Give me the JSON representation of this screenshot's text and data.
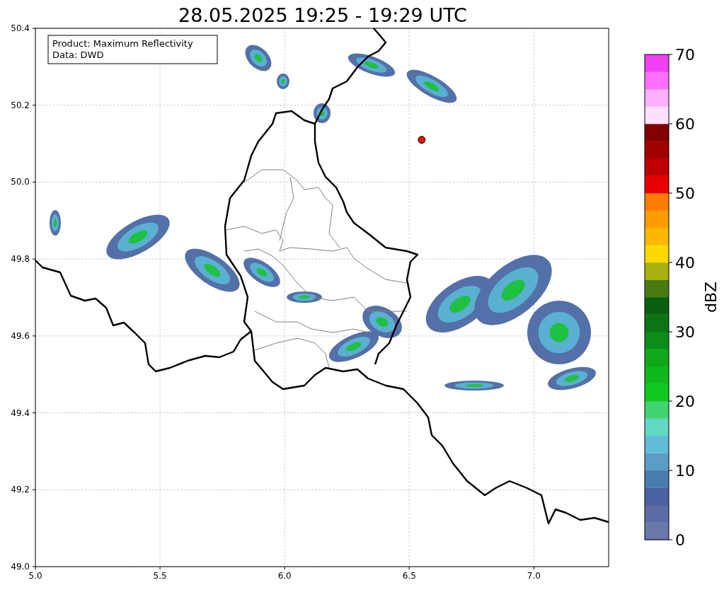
{
  "title": "28.05.2025 19:25 - 19:29 UTC",
  "map": {
    "info_box": [
      "Product: Maximum Reflectivity",
      "Data: DWD"
    ],
    "xticks": [
      "5.0",
      "5.5",
      "6.0",
      "6.5",
      "7.0"
    ],
    "yticks": [
      "50.4",
      "50.2",
      "50.0",
      "49.8",
      "49.6",
      "49.4",
      "49.2",
      "49.0"
    ]
  },
  "colorbar": {
    "label": "dBZ",
    "ticks": [
      "70",
      "60",
      "50",
      "40",
      "30",
      "20",
      "10",
      "0"
    ],
    "bands": [
      {
        "color": "#6878a8"
      },
      {
        "color": "#5a6ca4"
      },
      {
        "color": "#4a62a0"
      },
      {
        "color": "#4a7cb0"
      },
      {
        "color": "#5a9ec8"
      },
      {
        "color": "#60bcd8"
      },
      {
        "color": "#60d8c4"
      },
      {
        "color": "#40d470"
      },
      {
        "color": "#10c820"
      },
      {
        "color": "#10b81c"
      },
      {
        "color": "#10a818"
      },
      {
        "color": "#0c8c18"
      },
      {
        "color": "#0c7414"
      },
      {
        "color": "#0a6010"
      },
      {
        "color": "#4a7a10"
      },
      {
        "color": "#a8b010"
      },
      {
        "color": "#ffd800"
      },
      {
        "color": "#ffb800"
      },
      {
        "color": "#ff9c00"
      },
      {
        "color": "#ff7c00"
      },
      {
        "color": "#e80000"
      },
      {
        "color": "#c00000"
      },
      {
        "color": "#a00000"
      },
      {
        "color": "#800000"
      },
      {
        "color": "#ffe0ff"
      },
      {
        "color": "#ffb0ff"
      },
      {
        "color": "#ff70ff"
      },
      {
        "color": "#f040f0"
      }
    ]
  }
}
